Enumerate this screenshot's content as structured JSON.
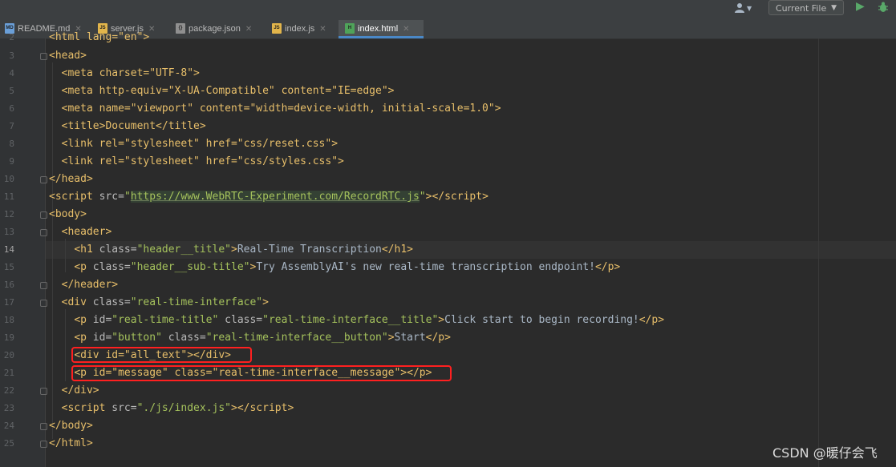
{
  "toolbar": {
    "user_icon": "user-icon",
    "run_config": "Current File",
    "run_icon": "run-icon",
    "debug_icon": "debug-icon"
  },
  "tabs": [
    {
      "label": "README.md",
      "icon": "MD",
      "icon_color": "#6a9fd8"
    },
    {
      "label": "server.js",
      "icon": "JS",
      "icon_color": "#e2b54b"
    },
    {
      "label": "package.json",
      "icon": "{}",
      "icon_color": "#8f8f8f"
    },
    {
      "label": "index.js",
      "icon": "JS",
      "icon_color": "#e2b54b"
    },
    {
      "label": "index.html",
      "icon": "H",
      "icon_color": "#4fa35a",
      "active": true
    }
  ],
  "editor": {
    "current_line": "14",
    "line_numbers": [
      "2",
      "3",
      "4",
      "5",
      "6",
      "7",
      "8",
      "9",
      "10",
      "11",
      "12",
      "13",
      "14",
      "15",
      "16",
      "17",
      "18",
      "19",
      "20",
      "21",
      "22",
      "23",
      "24",
      "25"
    ],
    "lines": {
      "l2_partial": "<html lang=\"en\">",
      "l3": "<head>",
      "l4": "<meta charset=\"UTF-8\">",
      "l5": "<meta http-equiv=\"X-UA-Compatible\" content=\"IE=edge\">",
      "l6": "<meta name=\"viewport\" content=\"width=device-width, initial-scale=1.0\">",
      "l7": "<title>Document</title>",
      "l8": "<link rel=\"stylesheet\" href=\"css/reset.css\">",
      "l9": "<link rel=\"stylesheet\" href=\"css/styles.css\">",
      "l10": "</head>",
      "l11_url": "https://www.WebRTC-Experiment.com/RecordRTC.js",
      "l12": "<body>",
      "l13": "<header>",
      "l14_text": "Real-Time Transcription",
      "l15_text": "Try AssemblyAI's new real-time transcription endpoint!",
      "l16": "</header>",
      "l18_text": "Click start to begin recording!",
      "l19_text": "Start",
      "l20": "<div id=\"all_text\"></div>",
      "l21": "<p id=\"message\" class=\"real-time-interface__message\"></p>",
      "l22": "</div>",
      "l23_src": "./js/index.js",
      "l24": "</body>",
      "l25": "</html>"
    }
  },
  "watermark": "CSDN @暖仔会飞"
}
